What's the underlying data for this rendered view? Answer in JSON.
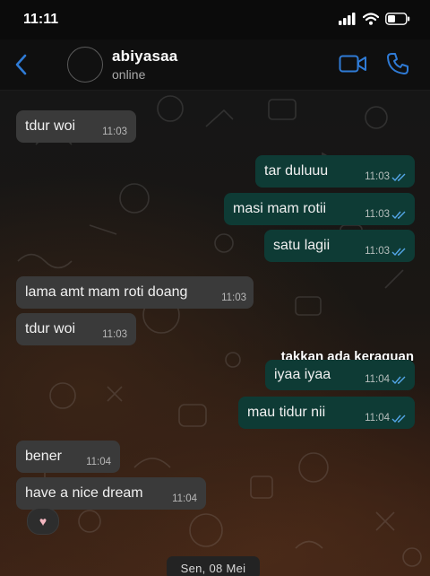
{
  "status_bar": {
    "time": "11:11"
  },
  "header": {
    "contact_name": "abiyasaa",
    "contact_status": "online"
  },
  "messages": [
    {
      "direction": "in",
      "text": "tdur woi",
      "time": "11:03"
    },
    {
      "direction": "out",
      "text": "tar duluuu",
      "time": "11:03",
      "read": true
    },
    {
      "direction": "out",
      "text": "masi mam rotii",
      "time": "11:03",
      "read": true
    },
    {
      "direction": "out",
      "text": "satu lagii",
      "time": "11:03",
      "read": true
    },
    {
      "direction": "in",
      "text": "lama amt mam roti doang",
      "time": "11:03"
    },
    {
      "direction": "in",
      "text": "tdur woi",
      "time": "11:03"
    },
    {
      "direction": "out",
      "text": "iyaa iyaa",
      "time": "11:04",
      "read": true
    },
    {
      "direction": "out",
      "text": "mau tidur nii",
      "time": "11:04",
      "read": true
    },
    {
      "direction": "in",
      "text": "bener",
      "time": "11:04"
    },
    {
      "direction": "in",
      "text": "have a nice dream",
      "time": "11:04"
    }
  ],
  "caption": "takkan ada keraguan",
  "reaction": {
    "emoji": "♥",
    "icon": "heart-icon"
  },
  "date_chip": "Sen, 08 Mei",
  "colors": {
    "accent": "#2f7bd6",
    "outgoing_bubble": "#0e3b35",
    "incoming_bubble": "#3a3a3a",
    "tick_read": "#53a6e8"
  }
}
